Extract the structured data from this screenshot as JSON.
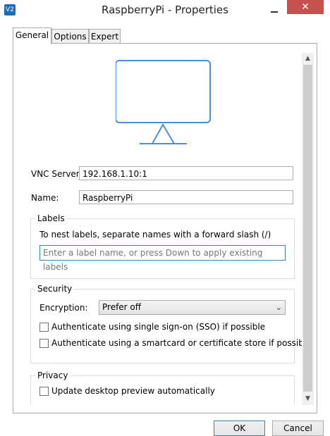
{
  "window": {
    "title": "RaspberryPi - Properties",
    "app_icon_text": "V2",
    "close_glyph": "✕"
  },
  "tabs": [
    {
      "label": "General",
      "active": true
    },
    {
      "label": "Options",
      "active": false
    },
    {
      "label": "Expert",
      "active": false
    }
  ],
  "general": {
    "vnc_server_label": "VNC Server:",
    "vnc_server_value": "192.168.1.10:1",
    "name_label": "Name:",
    "name_value": "RaspberryPi"
  },
  "labels_group": {
    "title": "Labels",
    "hint": "To nest labels, separate names with a forward slash (/)",
    "input_placeholder": "Enter a label name, or press Down to apply existing labels"
  },
  "security_group": {
    "title": "Security",
    "encryption_label": "Encryption:",
    "encryption_value": "Prefer off",
    "sso_label": "Authenticate using single sign-on (SSO) if possible",
    "smartcard_label": "Authenticate using a smartcard or certificate store if possible",
    "sso_checked": false,
    "smartcard_checked": false
  },
  "privacy_group": {
    "title": "Privacy",
    "preview_label": "Update desktop preview automatically",
    "preview_checked": false
  },
  "buttons": {
    "ok": "OK",
    "cancel": "Cancel"
  },
  "colors": {
    "accent": "#3c7fb1",
    "monitor_stroke": "#4a90d9",
    "close_red": "#c7504d"
  },
  "icons": {
    "app": "vnc-viewer-icon",
    "monitor": "monitor-icon",
    "minimize": "minimize-icon",
    "close": "close-icon",
    "dropdown": "chevron-down-icon",
    "scroll_up": "scroll-up-icon",
    "scroll_down": "scroll-down-icon"
  }
}
